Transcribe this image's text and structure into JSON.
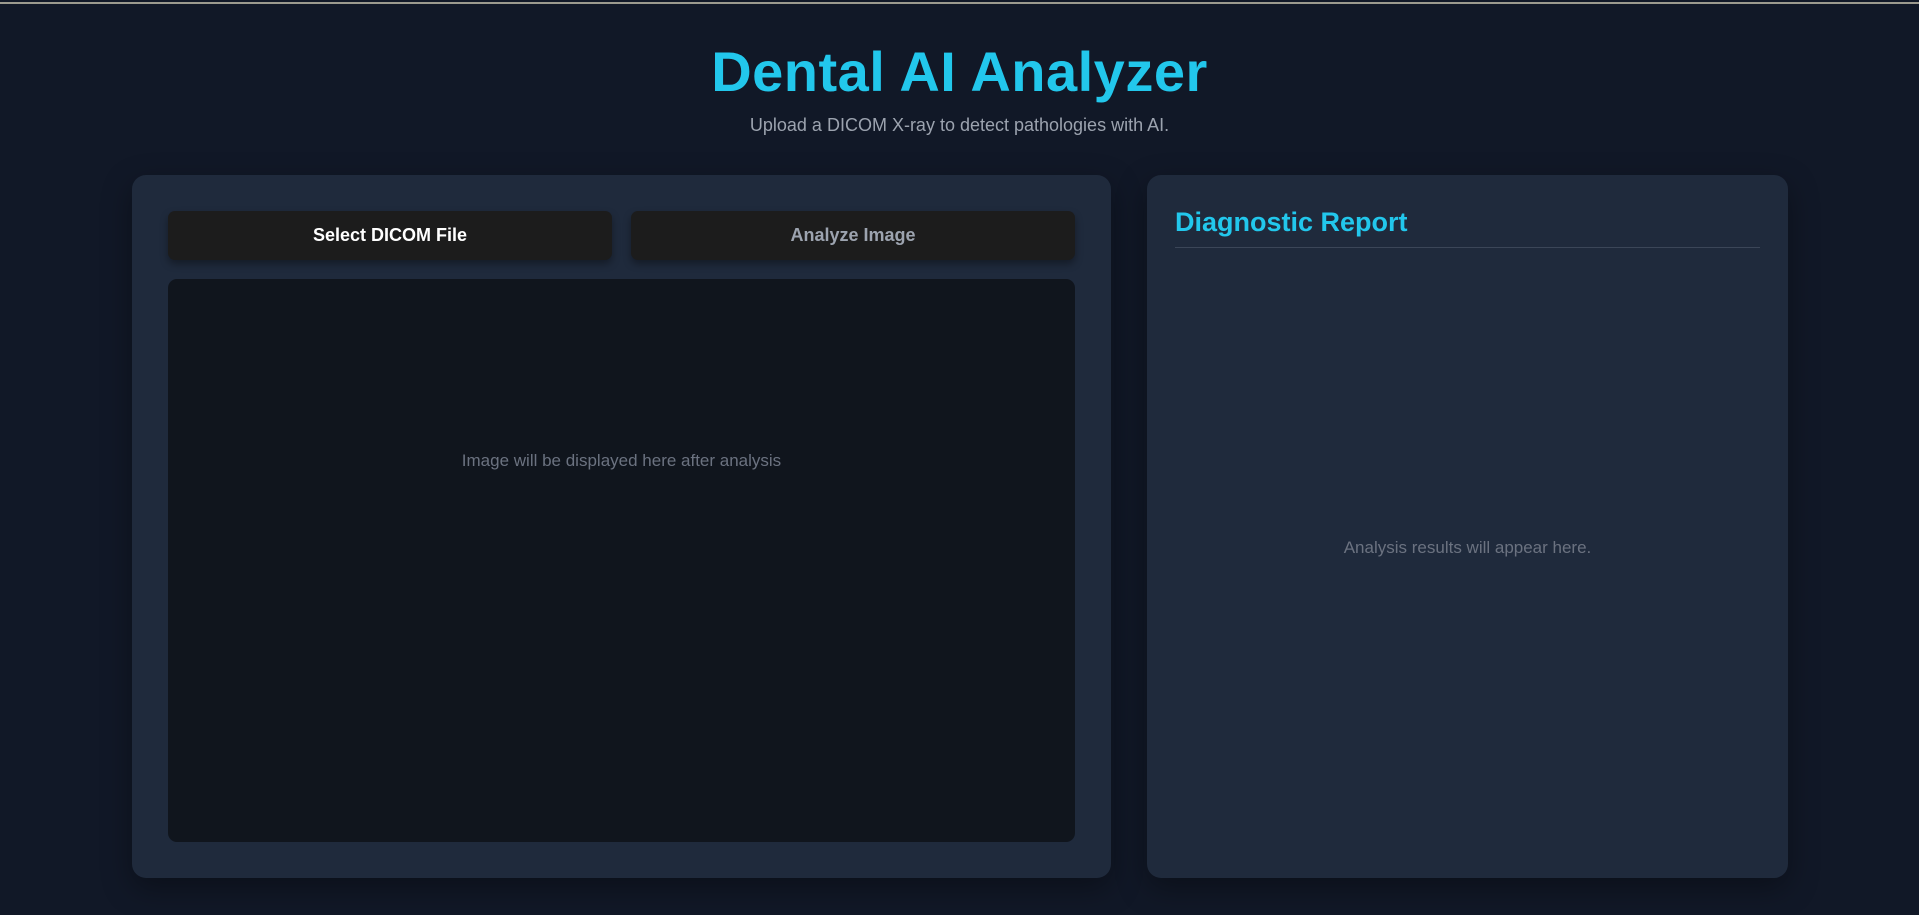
{
  "header": {
    "title": "Dental AI Analyzer",
    "subtitle": "Upload a DICOM X-ray to detect pathologies with AI."
  },
  "controls": {
    "select_label": "Select DICOM File",
    "analyze_label": "Analyze Image"
  },
  "viewer": {
    "placeholder": "Image will be displayed here after analysis"
  },
  "report": {
    "title": "Diagnostic Report",
    "placeholder": "Analysis results will appear here."
  },
  "colors": {
    "accent": "#22c7ec",
    "background": "#111827",
    "panel": "#1f2a3c",
    "button": "#1c1c1c",
    "muted_text": "#6b7280"
  }
}
